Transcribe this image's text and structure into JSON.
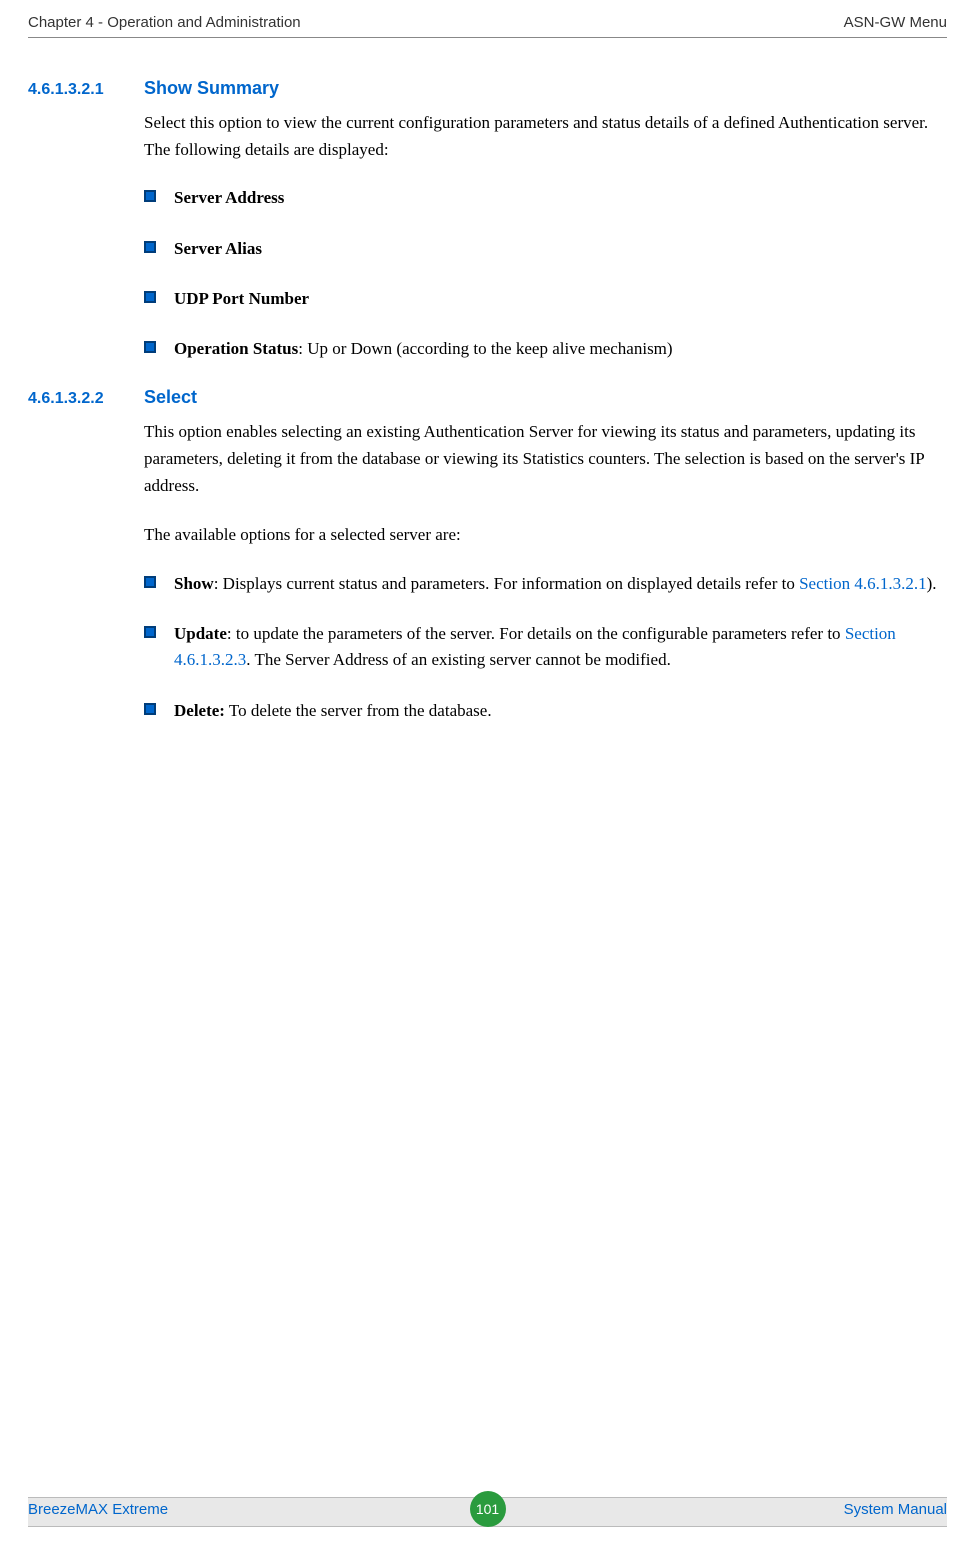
{
  "header": {
    "left": "Chapter 4 - Operation and Administration",
    "right": "ASN-GW Menu"
  },
  "sections": [
    {
      "number": "4.6.1.3.2.1",
      "title": "Show Summary",
      "intro": "Select this option to view the current configuration parameters and status details of a defined Authentication server. The following details are displayed:",
      "bullets": [
        {
          "bold": "Server Address",
          "rest": ""
        },
        {
          "bold": "Server Alias",
          "rest": ""
        },
        {
          "bold": "UDP Port Number",
          "rest": ""
        },
        {
          "bold": "Operation Status",
          "rest": ": Up or Down (according to the keep alive mechanism)"
        }
      ]
    },
    {
      "number": "4.6.1.3.2.2",
      "title": "Select",
      "intro": "This option enables selecting an existing Authentication Server for viewing its status and parameters, updating its parameters, deleting it from the database or viewing its Statistics counters. The selection is based on the server's IP address.",
      "intro2": "The available options for a selected server are:",
      "bullets2": [
        {
          "bold": "Show",
          "pre": ": Displays current status and parameters. For information on displayed details refer to ",
          "link": "Section 4.6.1.3.2.1",
          "post": ")."
        },
        {
          "bold": "Update",
          "pre": ": to update the parameters of the server. For details on the configurable parameters refer to ",
          "link": "Section 4.6.1.3.2.3",
          "post": ". The Server Address of an existing server cannot be modified."
        },
        {
          "bold": "Delete:",
          "pre": " To delete the server from the database.",
          "link": "",
          "post": ""
        }
      ]
    }
  ],
  "footer": {
    "left": "BreezeMAX Extreme",
    "page": "101",
    "right": "System Manual"
  }
}
